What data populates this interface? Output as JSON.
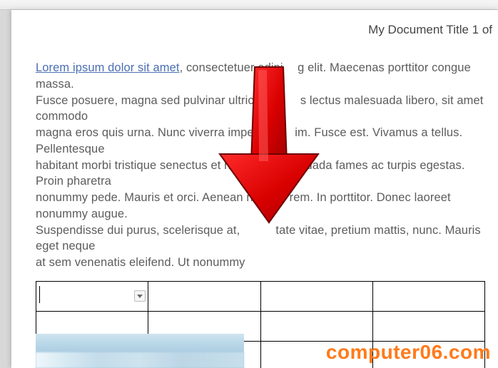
{
  "header": {
    "title_right": "My Document Title 1 of"
  },
  "body": {
    "link_text": "Lorem ipsum dolor sit amet",
    "para_after_link_line1": ", consectetuer adipi",
    "para_after_gap1": "g elit. Maecenas porttitor congue massa.",
    "line2a": "Fusce posuere, magna sed pulvinar ultricies, p",
    "line2b": "s lectus malesuada libero, sit amet commodo",
    "line3a": "magna eros quis urna. Nunc viverra imperdiet",
    "line3b": "im. Fusce est. Vivamus a tellus. Pellentesque",
    "line4a": "habitant morbi tristique senectus et netus et",
    "line4b": "lesuada fames ac turpis egestas. Proin pharetra",
    "line5a": "nonummy pede. Mauris et orci. Aenean ne",
    "line5b": "rem. In porttitor. Donec laoreet nonummy augue.",
    "line6a": "Suspendisse dui purus, scelerisque at,",
    "line6b": "tate vitae, pretium mattis, nunc. Mauris eget neque",
    "line7": "at sem venenatis eleifend. Ut nonummy"
  },
  "table": {
    "rows": 3,
    "cols": 4,
    "cells": [
      [
        "",
        "",
        "",
        ""
      ],
      [
        "",
        "",
        "",
        ""
      ],
      [
        "",
        "",
        "",
        ""
      ]
    ]
  },
  "annotation": {
    "arrow_color": "#d90000"
  },
  "watermark": {
    "text": "computer06.com"
  }
}
